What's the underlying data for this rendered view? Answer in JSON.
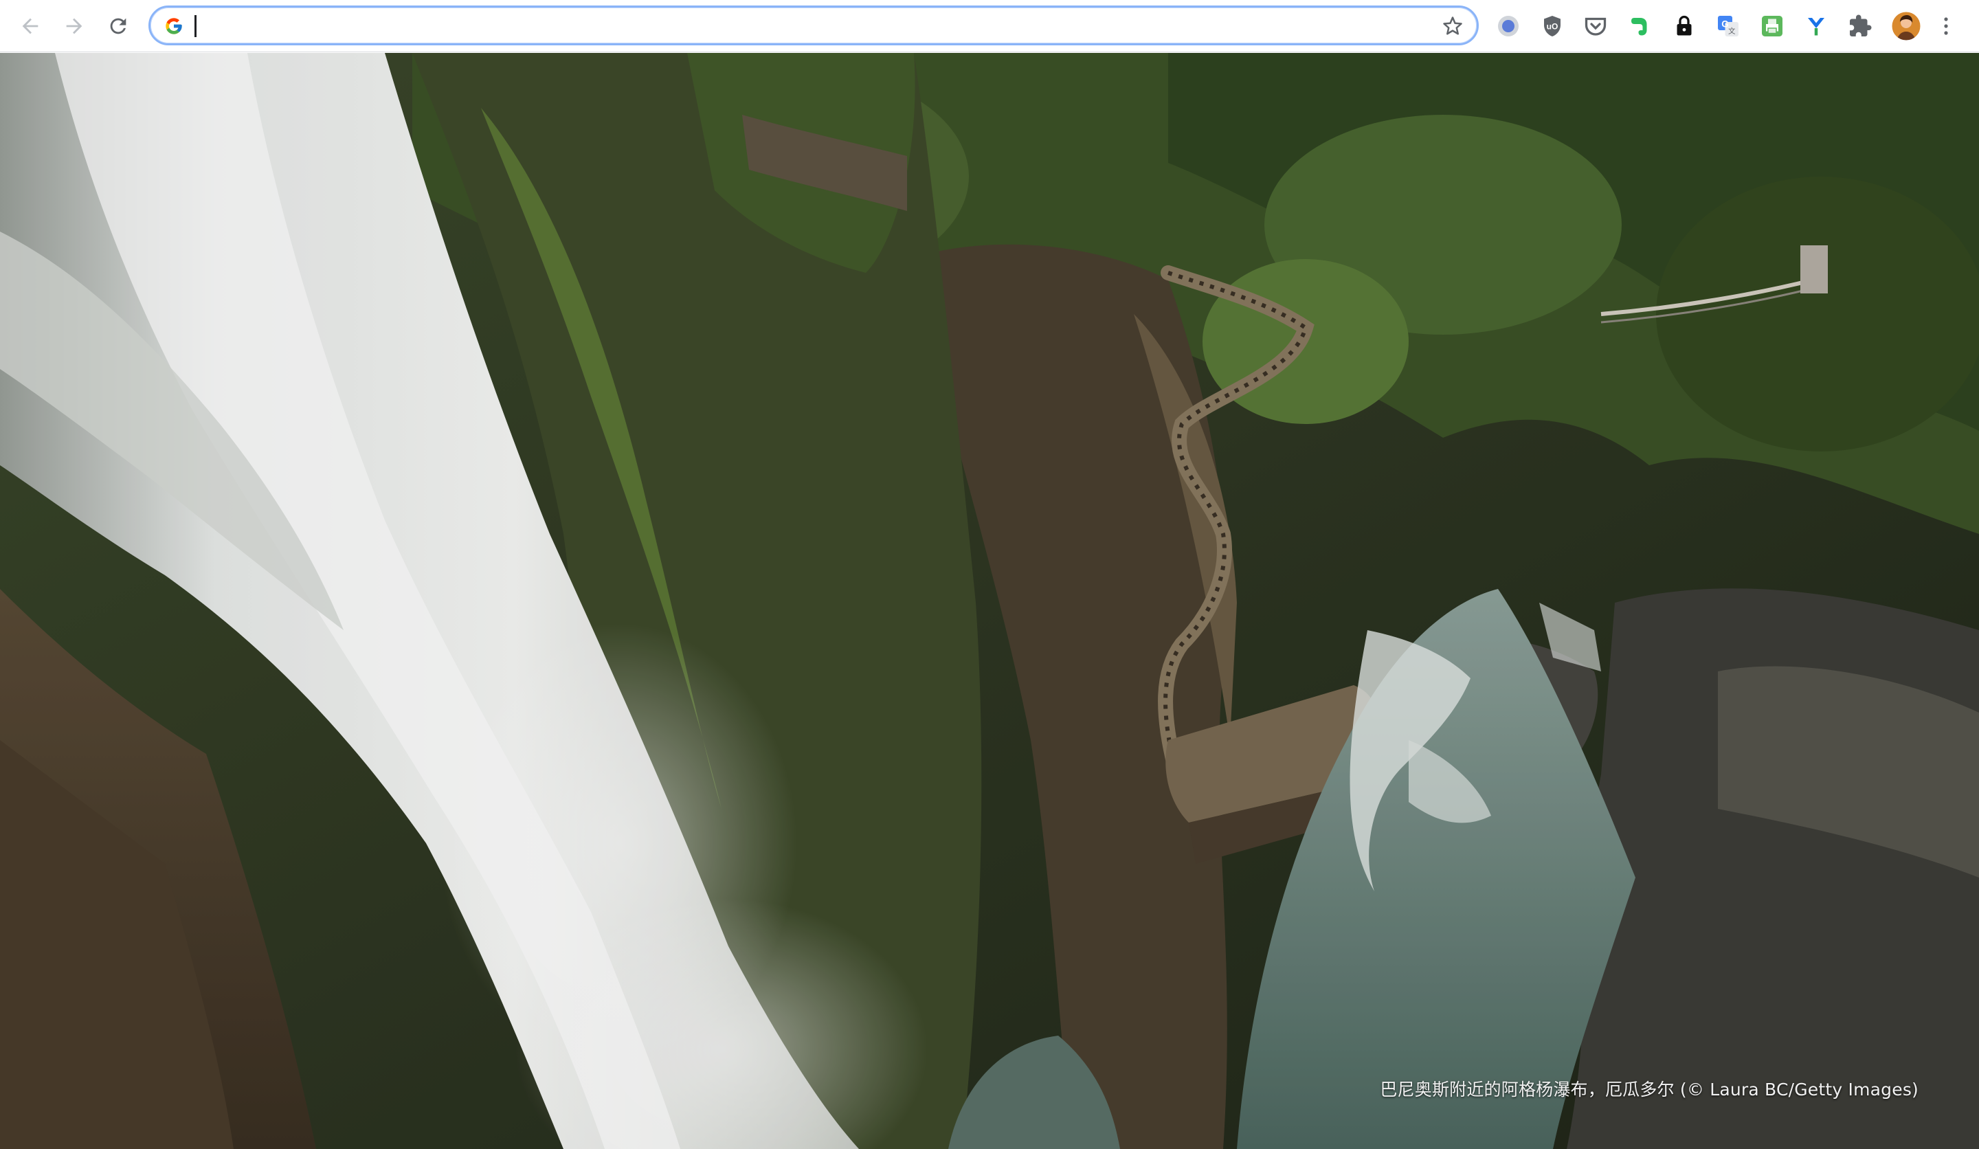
{
  "browser": {
    "omnibox_value": "",
    "nav": {
      "back_icon": "arrow-left-icon",
      "forward_icon": "arrow-right-icon",
      "reload_icon": "reload-icon"
    },
    "extensions": [
      "circle-extension-icon",
      "ublock-icon",
      "pocket-icon",
      "evernote-icon",
      "lock-icon",
      "google-translate-icon",
      "printer-green-icon",
      "y-extension-icon",
      "puzzle-icon",
      "profile-avatar",
      "kebab-menu-icon"
    ]
  },
  "background": {
    "caption": "巴尼奥斯附近的阿格杨瀑布，厄瓜多尔 (© Laura BC/Getty Images)"
  },
  "colors": {
    "omnibox_focus": "#8ab4f8",
    "toolbar_bg": "#ffffff",
    "icon_gray": "#5f6368"
  }
}
